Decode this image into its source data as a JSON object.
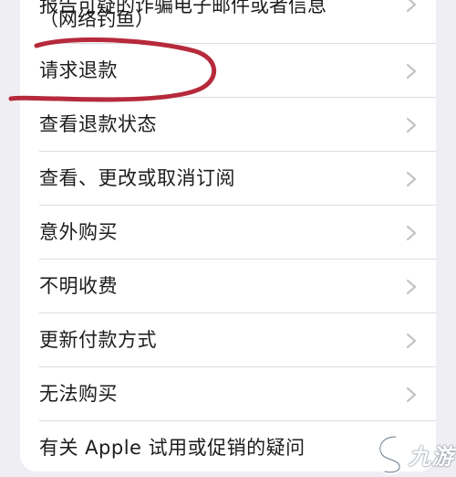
{
  "menu": {
    "items": [
      {
        "label": "报告可疑的诈骗电子邮件或者信息",
        "label_line2": "（网络钓鱼）"
      },
      {
        "label": "请求退款"
      },
      {
        "label": "查看退款状态"
      },
      {
        "label": "查看、更改或取消订阅"
      },
      {
        "label": "意外购买"
      },
      {
        "label": "不明收费"
      },
      {
        "label": "更新付款方式"
      },
      {
        "label": "无法购买"
      },
      {
        "label": "有关 Apple 试用或促销的疑问"
      }
    ]
  },
  "watermark": {
    "text": "九游"
  },
  "colors": {
    "background": "#efeef3",
    "card": "#ffffff",
    "text": "#1c1c1e",
    "chevron": "#c4c4c7",
    "annotation_circle": "#b0182a"
  },
  "icons": {
    "row_chevron": "chevron-right-icon",
    "watermark_logo": "jiuyou-logo-icon"
  }
}
